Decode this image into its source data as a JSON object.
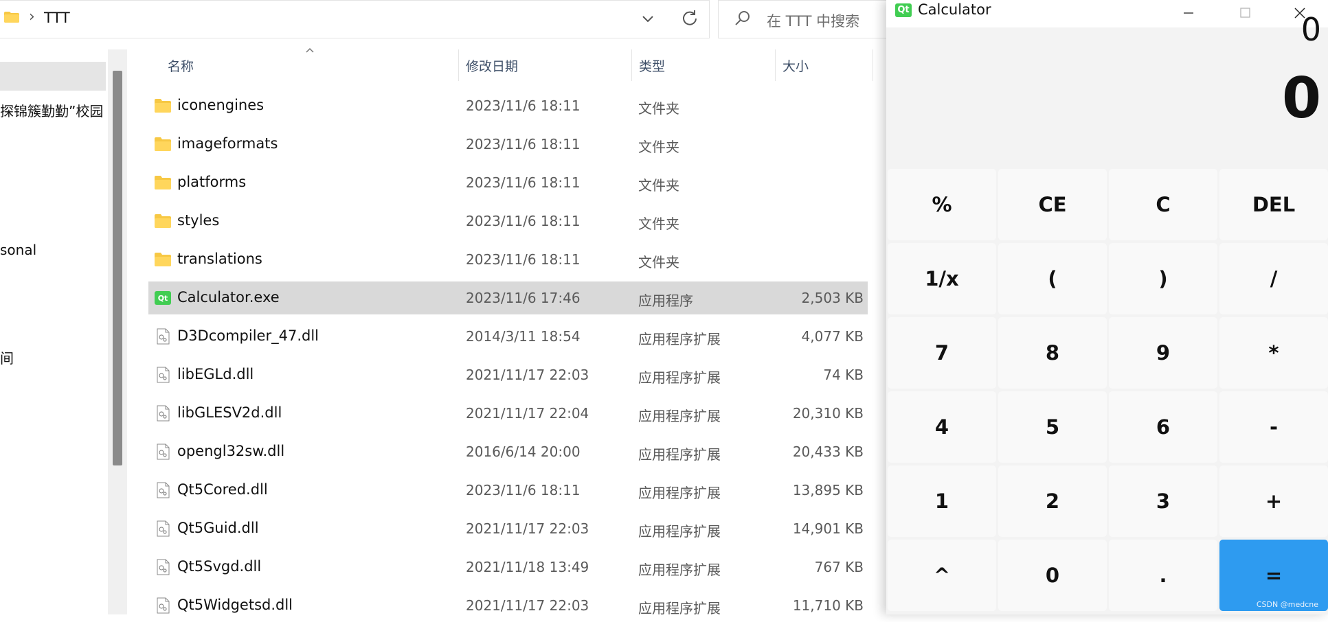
{
  "explorer": {
    "breadcrumb": {
      "separator": "›",
      "current": "TTT"
    },
    "search_placeholder": "在 TTT 中搜索",
    "nav": {
      "items": [
        {
          "label": "探锦簇勤勤”校园",
          "top": 0
        },
        {
          "label": "sonal"
        },
        {
          "label": "间"
        }
      ]
    },
    "columns": {
      "name": "名称",
      "date": "修改日期",
      "type": "类型",
      "size": "大小"
    },
    "files": [
      {
        "name": "iconengines",
        "date": "2023/11/6 18:11",
        "type": "文件夹",
        "size": "",
        "icon": "folder-icon"
      },
      {
        "name": "imageformats",
        "date": "2023/11/6 18:11",
        "type": "文件夹",
        "size": "",
        "icon": "folder-icon"
      },
      {
        "name": "platforms",
        "date": "2023/11/6 18:11",
        "type": "文件夹",
        "size": "",
        "icon": "folder-icon"
      },
      {
        "name": "styles",
        "date": "2023/11/6 18:11",
        "type": "文件夹",
        "size": "",
        "icon": "folder-icon"
      },
      {
        "name": "translations",
        "date": "2023/11/6 18:11",
        "type": "文件夹",
        "size": "",
        "icon": "folder-icon"
      },
      {
        "name": "Calculator.exe",
        "date": "2023/11/6 17:46",
        "type": "应用程序",
        "size": "2,503 KB",
        "icon": "qt-app-icon",
        "selected": true
      },
      {
        "name": "D3Dcompiler_47.dll",
        "date": "2014/3/11 18:54",
        "type": "应用程序扩展",
        "size": "4,077 KB",
        "icon": "dll-icon"
      },
      {
        "name": "libEGLd.dll",
        "date": "2021/11/17 22:03",
        "type": "应用程序扩展",
        "size": "74 KB",
        "icon": "dll-icon"
      },
      {
        "name": "libGLESV2d.dll",
        "date": "2021/11/17 22:04",
        "type": "应用程序扩展",
        "size": "20,310 KB",
        "icon": "dll-icon"
      },
      {
        "name": "opengl32sw.dll",
        "date": "2016/6/14 20:00",
        "type": "应用程序扩展",
        "size": "20,433 KB",
        "icon": "dll-icon"
      },
      {
        "name": "Qt5Cored.dll",
        "date": "2023/11/6 18:11",
        "type": "应用程序扩展",
        "size": "13,895 KB",
        "icon": "dll-icon"
      },
      {
        "name": "Qt5Guid.dll",
        "date": "2021/11/17 22:03",
        "type": "应用程序扩展",
        "size": "14,901 KB",
        "icon": "dll-icon"
      },
      {
        "name": "Qt5Svgd.dll",
        "date": "2021/11/18 13:49",
        "type": "应用程序扩展",
        "size": "767 KB",
        "icon": "dll-icon"
      },
      {
        "name": "Qt5Widgetsd.dll",
        "date": "2021/11/17 22:03",
        "type": "应用程序扩展",
        "size": "11,710 KB",
        "icon": "dll-icon"
      }
    ]
  },
  "calculator": {
    "title": "Calculator",
    "logo_text": "Qt",
    "expression": "0",
    "result": "0",
    "keys": [
      [
        "%",
        "CE",
        "C",
        "DEL"
      ],
      [
        "1/x",
        "(",
        ")",
        "/"
      ],
      [
        "7",
        "8",
        "9",
        "*"
      ],
      [
        "4",
        "5",
        "6",
        "-"
      ],
      [
        "1",
        "2",
        "3",
        "+"
      ],
      [
        "^",
        "0",
        ".",
        "="
      ]
    ],
    "equals_color": "#2e9bf0",
    "watermark": "CSDN @medcne"
  },
  "colors": {
    "selection": "#d9d9d9",
    "folder": "#f7c844",
    "qt_green": "#41cd52"
  }
}
